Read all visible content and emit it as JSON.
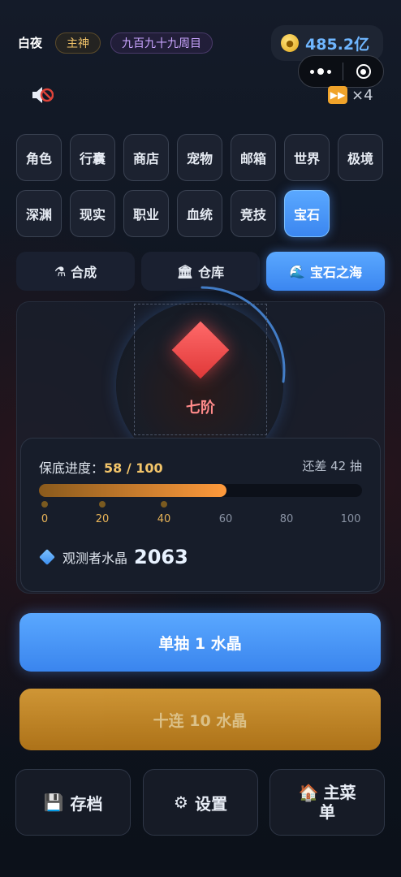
{
  "header": {
    "player_name": "白夜",
    "class_badge": "主神",
    "cycle_badge": "九百九十九周目",
    "currency": {
      "icon": "gold-coin-icon",
      "value": "485.2亿",
      "color": "#6fb6ff"
    },
    "speed_label": "×4"
  },
  "nav": {
    "row1": [
      "角色",
      "行囊",
      "商店",
      "宠物",
      "邮箱",
      "世界",
      "极境"
    ],
    "row2": [
      "深渊",
      "现实",
      "职业",
      "血统",
      "竞技",
      "宝石"
    ],
    "active": "宝石"
  },
  "tabs": [
    {
      "icon": "⚗",
      "label": "合成"
    },
    {
      "icon": "🏛",
      "label": "仓库"
    },
    {
      "icon": "🌊",
      "label": "宝石之海",
      "active": true
    }
  ],
  "gem": {
    "tier": "七阶",
    "color": "#ff5a5a"
  },
  "pity": {
    "label": "保底进度：",
    "value": "58 / 100",
    "progress": 0.58,
    "remaining": "还差 42 抽",
    "ticks": [
      "0",
      "20",
      "40",
      "60",
      "80",
      "100"
    ]
  },
  "crystal": {
    "label": "观测者水晶",
    "value": "2063"
  },
  "actions": {
    "single": "单抽 1 水晶",
    "ten": "十连 10 水晶"
  },
  "bottom": {
    "save": {
      "icon": "💾",
      "label": "存档"
    },
    "settings": {
      "icon": "⚙",
      "label": "设置"
    },
    "menu": {
      "icon": "🏠",
      "label_line1": "主菜",
      "label_line2": "单"
    }
  },
  "colors": {
    "accent_blue": "#4a98f8",
    "accent_gold": "#e9a93a",
    "tier_red": "#ff8a8a"
  }
}
